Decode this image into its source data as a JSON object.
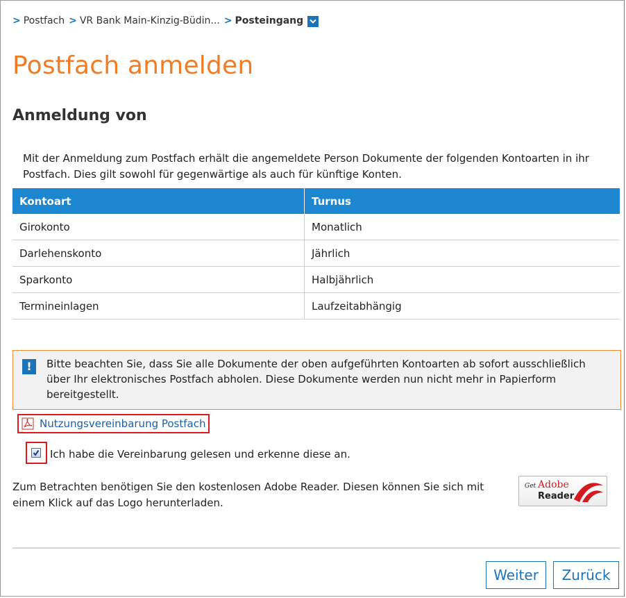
{
  "breadcrumb": {
    "items": [
      "Postfach",
      "VR Bank Main-Kinzig-Büdin..."
    ],
    "current": "Posteingang"
  },
  "page": {
    "title": "Postfach anmelden",
    "section_heading": "Anmeldung von",
    "intro": "Mit der Anmeldung zum Postfach erhält die angemeldete Person Dokumente der folgenden Kontoarten in ihr Postfach. Dies gilt sowohl für gegenwärtige als auch für künftige Konten."
  },
  "table": {
    "headers": [
      "Kontoart",
      "Turnus"
    ],
    "rows": [
      [
        "Girokonto",
        "Monatlich"
      ],
      [
        "Darlehenskonto",
        "Jährlich"
      ],
      [
        "Sparkonto",
        "Halbjährlich"
      ],
      [
        "Termineinlagen",
        "Laufzeitabhängig"
      ]
    ]
  },
  "notice": {
    "icon_text": "!",
    "text": "Bitte beachten Sie, dass Sie alle Dokumente der oben aufgeführten Kontoarten ab sofort ausschließlich über Ihr elektronisches Postfach abholen. Diese Dokumente werden nun nicht mehr in Papierform bereitgestellt."
  },
  "agreement": {
    "link_label": "Nutzungsvereinbarung Postfach",
    "checkbox_label": "Ich habe die Vereinbarung gelesen und erkenne diese an.",
    "checked": true
  },
  "reader": {
    "text": "Zum Betrachten benötigen Sie den kostenlosen Adobe Reader. Diesen können Sie sich mit einem Klick auf das Logo herunterladen.",
    "logo_get": "Get",
    "logo_brand": "Adobe",
    "logo_product": "Reader"
  },
  "buttons": {
    "next": "Weiter",
    "back": "Zurück"
  },
  "colors": {
    "accent_blue": "#1c73b8",
    "title_orange": "#f07d26",
    "highlight_red": "#e0191f"
  }
}
